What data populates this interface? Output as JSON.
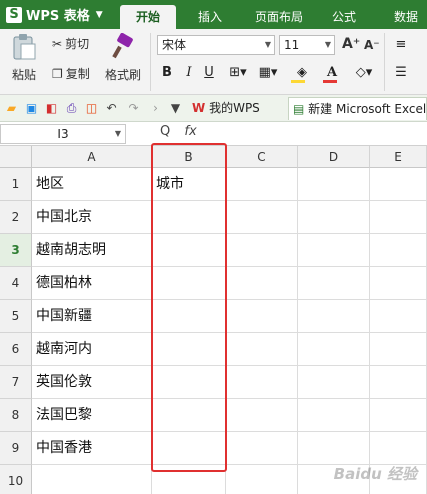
{
  "app": {
    "name": "WPS 表格",
    "logo": "S"
  },
  "menu": {
    "tabs": [
      "开始",
      "插入",
      "页面布局",
      "公式",
      "数据"
    ],
    "active": "开始"
  },
  "ribbon": {
    "paste": "粘贴",
    "cut": "剪切",
    "copy": "复制",
    "format_painter": "格式刷",
    "font_name": "宋体",
    "font_size": "11",
    "bold": "B",
    "italic": "I",
    "underline": "U",
    "grow_font": "A⁺",
    "shrink_font": "A⁻",
    "font_color": "A",
    "font_color_value": "#e53935",
    "fill_color_value": "#fdd835"
  },
  "quickbar": {
    "tabs": [
      {
        "label": "我的WPS"
      },
      {
        "label": "新建 Microsoft Excel"
      }
    ]
  },
  "formula_bar": {
    "name_box": "I3",
    "fx": "fx",
    "zoom_icon": "Q"
  },
  "sheet": {
    "columns": [
      "A",
      "B",
      "C",
      "D",
      "E"
    ],
    "rows": [
      "1",
      "2",
      "3",
      "4",
      "5",
      "6",
      "7",
      "8",
      "9",
      "10"
    ],
    "selected_row": "3",
    "cells": {
      "A": [
        "地区",
        "中国北京",
        "越南胡志明",
        "德国柏林",
        "中国新疆",
        "越南河内",
        "英国伦敦",
        "法国巴黎",
        "中国香港",
        ""
      ],
      "B": [
        "城市",
        "",
        "",
        "",
        "",
        "",
        "",
        "",
        "",
        ""
      ]
    }
  },
  "highlight_color": "#e03030",
  "accent": "#2e7d32",
  "watermark": "Baidu 经验"
}
